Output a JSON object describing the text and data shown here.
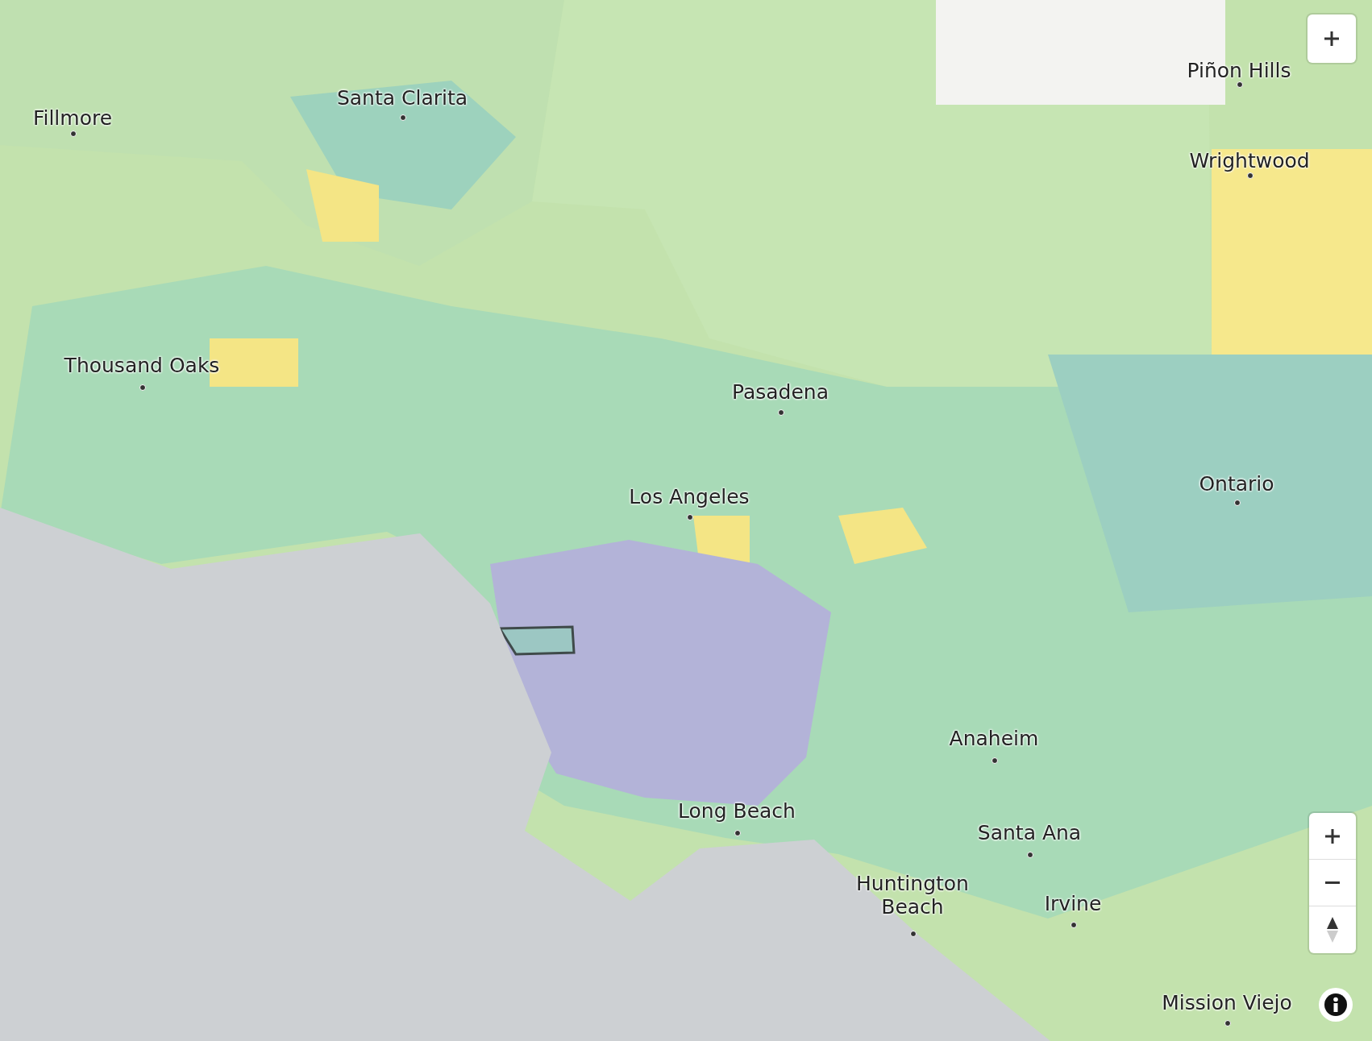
{
  "map": {
    "places": [
      {
        "name": "Santa Clarita"
      },
      {
        "name": "Fillmore"
      },
      {
        "name": "Piñon Hills"
      },
      {
        "name": "Wrightwood"
      },
      {
        "name": "Thousand Oaks"
      },
      {
        "name": "Pasadena"
      },
      {
        "name": "Los Angeles"
      },
      {
        "name": "Ontario"
      },
      {
        "name": "Anaheim"
      },
      {
        "name": "Long Beach"
      },
      {
        "name": "Santa Ana"
      },
      {
        "name": "Huntington Beach"
      },
      {
        "name": "Irvine"
      },
      {
        "name": "Mission Viejo"
      }
    ]
  }
}
